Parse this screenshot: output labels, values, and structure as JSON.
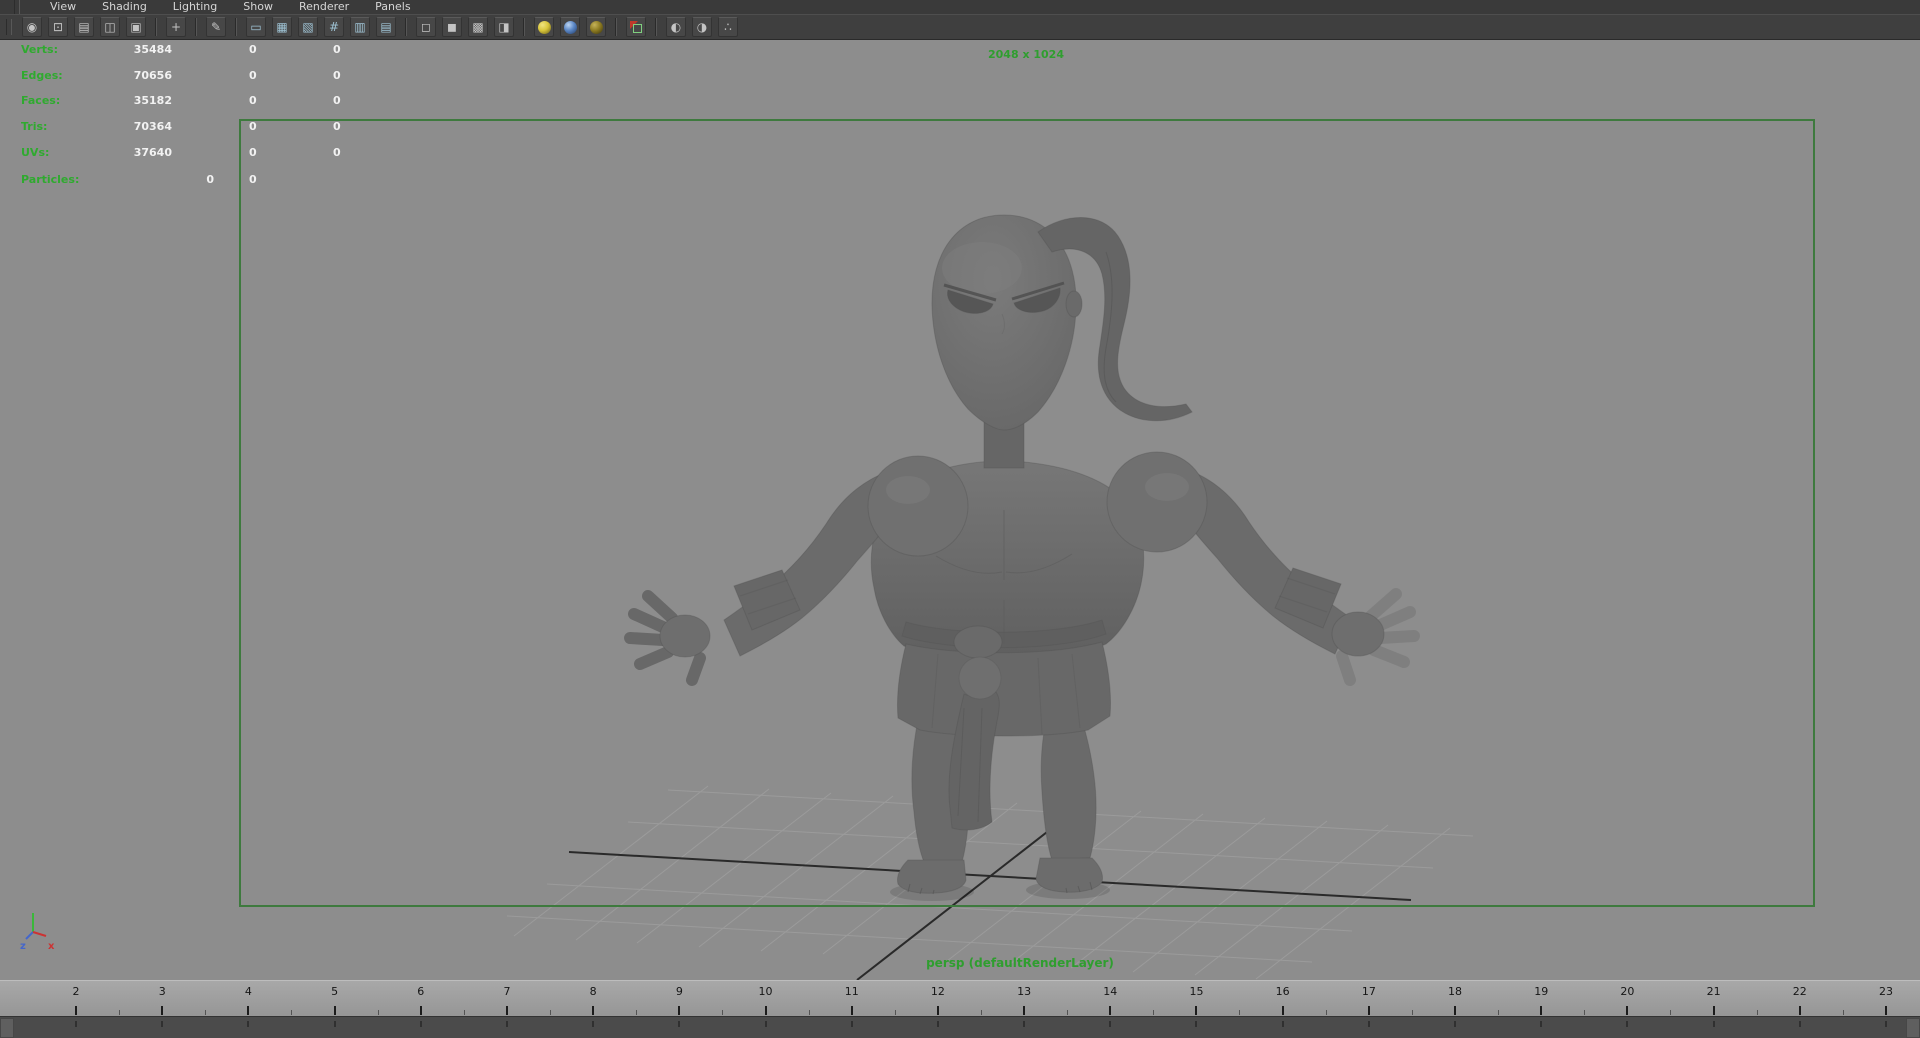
{
  "menu": {
    "items": [
      "View",
      "Shading",
      "Lighting",
      "Show",
      "Renderer",
      "Panels"
    ]
  },
  "toolbar": {
    "icons": [
      {
        "name": "select-camera-icon",
        "kind": "glyph",
        "g": "◉"
      },
      {
        "name": "lock-camera-icon",
        "kind": "glyph",
        "g": "⊡"
      },
      {
        "name": "camera-attributes-icon",
        "kind": "glyph",
        "g": "▤"
      },
      {
        "name": "bookmarks-icon",
        "kind": "glyph",
        "g": "◫"
      },
      {
        "name": "image-plane-icon",
        "kind": "glyph",
        "g": "▣"
      },
      {
        "kind": "sep"
      },
      {
        "name": "two-d-pan-zoom-icon",
        "kind": "glyph",
        "g": "+"
      },
      {
        "kind": "sep"
      },
      {
        "name": "grease-pencil-icon",
        "kind": "glyph",
        "g": "✎"
      },
      {
        "kind": "sep"
      },
      {
        "name": "film-gate-icon",
        "kind": "glyph",
        "g": "▭",
        "tint": "#9fc3d4"
      },
      {
        "name": "resolution-gate-icon",
        "kind": "glyph",
        "g": "▦",
        "tint": "#9fc3d4"
      },
      {
        "name": "gate-mask-icon",
        "kind": "glyph",
        "g": "▧",
        "tint": "#9fc3d4"
      },
      {
        "name": "field-chart-icon",
        "kind": "glyph",
        "g": "#",
        "tint": "#9fc3d4"
      },
      {
        "name": "safe-action-icon",
        "kind": "glyph",
        "g": "▥",
        "tint": "#9fc3d4"
      },
      {
        "name": "safe-title-icon",
        "kind": "glyph",
        "g": "▤",
        "tint": "#9fc3d4"
      },
      {
        "kind": "sep"
      },
      {
        "name": "wireframe-icon",
        "kind": "glyph",
        "g": "◻"
      },
      {
        "name": "shaded-icon",
        "kind": "glyph",
        "g": "◼"
      },
      {
        "name": "textured-icon",
        "kind": "glyph",
        "g": "▩"
      },
      {
        "name": "default-material-icon",
        "kind": "glyph",
        "g": "◨"
      },
      {
        "kind": "sep"
      },
      {
        "name": "all-lights-icon",
        "kind": "sphere",
        "color": "yellow"
      },
      {
        "name": "shadows-icon",
        "kind": "sphere",
        "color": "blue"
      },
      {
        "name": "ambient-occlusion-icon",
        "kind": "sphere",
        "color": "darkyellow"
      },
      {
        "kind": "sep"
      },
      {
        "name": "isolate-select-icon",
        "kind": "isolate"
      },
      {
        "kind": "sep"
      },
      {
        "name": "xray-icon",
        "kind": "glyph",
        "g": "◐"
      },
      {
        "name": "xray-joints-icon",
        "kind": "glyph",
        "g": "◑"
      },
      {
        "name": "plugin-shapes-icon",
        "kind": "glyph",
        "g": "∴"
      }
    ]
  },
  "hud": {
    "rows": [
      {
        "label": "Verts:",
        "value": "35484",
        "c2": "0",
        "c3": "0"
      },
      {
        "label": "Edges:",
        "value": "70656",
        "c2": "0",
        "c3": "0"
      },
      {
        "label": "Faces:",
        "value": "35182",
        "c2": "0",
        "c3": "0"
      },
      {
        "label": "Tris:",
        "value": "70364",
        "c2": "0",
        "c3": "0"
      },
      {
        "label": "UVs:",
        "value": "37640",
        "c2": "0",
        "c3": "0"
      },
      {
        "label": "Particles:",
        "value": "0",
        "c2": "0",
        "c3": "",
        "wide": true
      }
    ]
  },
  "viewport": {
    "resolution_label": "2048 x 1024",
    "camera_label": "persp (defaultRenderLayer)"
  },
  "axis": {
    "x": "x",
    "z": "z"
  },
  "timeline": {
    "frames": [
      "2",
      "3",
      "4",
      "5",
      "6",
      "7",
      "8",
      "9",
      "10",
      "11",
      "12",
      "13",
      "14",
      "15",
      "16",
      "17",
      "18",
      "19",
      "20",
      "21",
      "22",
      "23"
    ]
  },
  "colors": {
    "hud_green": "#2faa2f",
    "gate_green": "#3e7a3e",
    "viewport_bg": "#8d8d8d",
    "model_gray": "#6d6d6d",
    "axis_x_red": "#cc3333",
    "axis_y_green": "#3ab83a",
    "axis_z_blue": "#4466cc"
  }
}
